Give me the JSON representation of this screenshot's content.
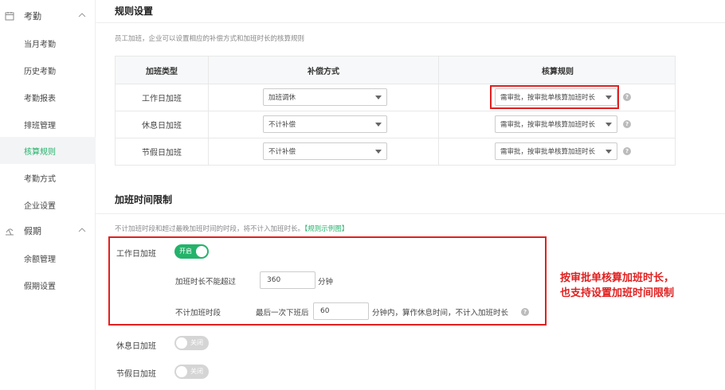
{
  "sidebar": {
    "group_attendance": "考勤",
    "attendance_items": [
      "当月考勤",
      "历史考勤",
      "考勤报表",
      "排班管理",
      "核算规则",
      "考勤方式",
      "企业设置"
    ],
    "group_leave": "假期",
    "leave_items": [
      "余额管理",
      "假期设置"
    ]
  },
  "rules": {
    "title": "规则设置",
    "desc": "员工加班，企业可以设置相应的补偿方式和加班时长的核算规则",
    "headers": [
      "加班类型",
      "补偿方式",
      "核算规则"
    ],
    "rows": [
      {
        "type": "工作日加班",
        "comp": "加班调休",
        "rule": "需审批，按审批单核算加班时长"
      },
      {
        "type": "休息日加班",
        "comp": "不计补偿",
        "rule": "需审批，按审批单核算加班时长"
      },
      {
        "type": "节假日加班",
        "comp": "不计补偿",
        "rule": "需审批，按审批单核算加班时长"
      }
    ]
  },
  "limit": {
    "title": "加班时间限制",
    "desc": "不计加班时段和超过最晚加班时间的时段，将不计入加班时长。",
    "link": "【规则示例图】",
    "workday_label": "工作日加班",
    "toggle_on": "开启",
    "toggle_off": "关闭",
    "max_label": "加班时长不能超过",
    "max_value": "360",
    "max_unit": "分钟",
    "exclude_label": "不计加班时段",
    "after_label": "最后一次下班后",
    "after_value": "60",
    "after_suffix": "分钟内，算作休息时间，不计入加班时长",
    "restday_label": "休息日加班",
    "holiday_label": "节假日加班"
  },
  "annotation": {
    "line1": "按审批单核算加班时长，",
    "line2": "也支持设置加班时间限制"
  },
  "colors": {
    "accent": "#23b36b",
    "highlight": "#e02020"
  },
  "icons": {
    "attendance": "calendar-icon",
    "leave": "beach-icon",
    "help": "question-icon"
  }
}
